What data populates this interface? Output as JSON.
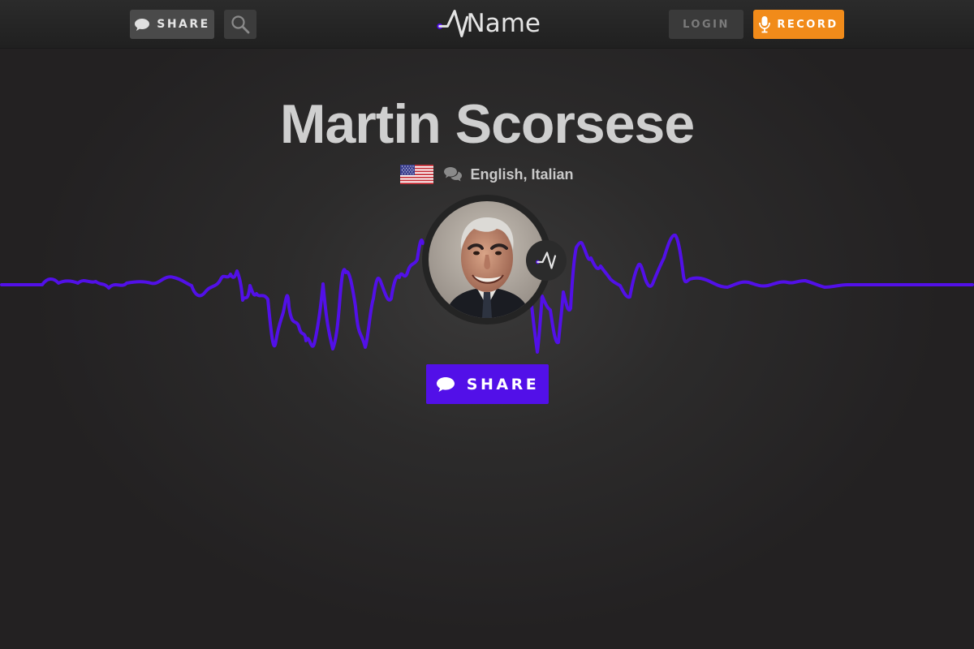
{
  "header": {
    "share_label": "SHARE",
    "logo_text": "Name",
    "login_label": "LOGIN",
    "record_label": "RECORD"
  },
  "profile": {
    "name": "Martin Scorsese",
    "languages": "English, Italian",
    "flag": "us-flag-icon"
  },
  "actions": {
    "share_label": "SHARE"
  },
  "colors": {
    "accent": "#5210e8",
    "record": "#f18b1a",
    "background": "#2c2b2b"
  },
  "icons": [
    "chat-bubble-icon",
    "search-icon",
    "microphone-icon",
    "languages-icon",
    "logo-mark-icon"
  ]
}
